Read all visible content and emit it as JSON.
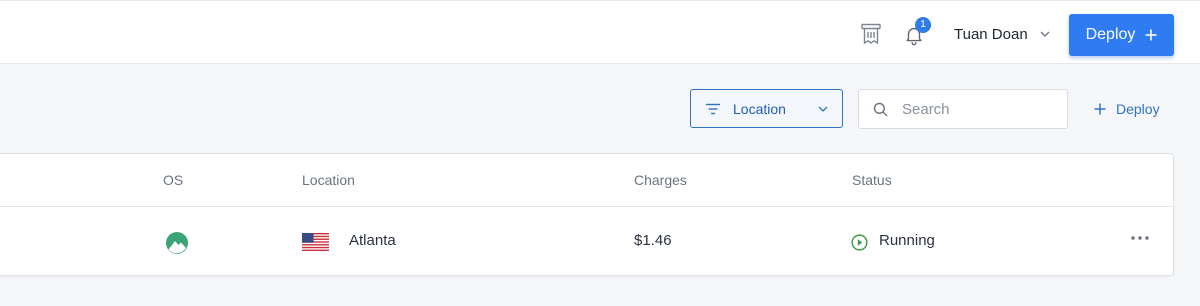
{
  "header": {
    "user_name": "Tuan Doan",
    "notification_count": "1",
    "deploy_label": "Deploy",
    "icons": {
      "docs": "docs-icon",
      "notifications": "bell-icon",
      "user_menu": "chevron-down-icon",
      "deploy": "plus-icon"
    }
  },
  "toolbar": {
    "filter_label": "Location",
    "search_placeholder": "Search",
    "deploy_link_label": "Deploy",
    "icons": {
      "filter": "filter-lines-icon",
      "filter_dropdown": "chevron-down-icon",
      "search": "search-icon",
      "deploy_link": "plus-icon"
    }
  },
  "table": {
    "columns": {
      "os": "OS",
      "location": "Location",
      "charges": "Charges",
      "status": "Status"
    },
    "rows": [
      {
        "os_icon": "os-logo-icon",
        "location_flag": "us-flag-icon",
        "location": "Atlanta",
        "charges": "$1.46",
        "status": "Running",
        "status_icon": "play-circle-icon",
        "actions_icon": "more-horizontal-icon"
      }
    ]
  },
  "colors": {
    "accent": "#2f7bf2",
    "link": "#2f73c7",
    "status_running": "#3f9a45",
    "os_logo": "#3aa474"
  }
}
